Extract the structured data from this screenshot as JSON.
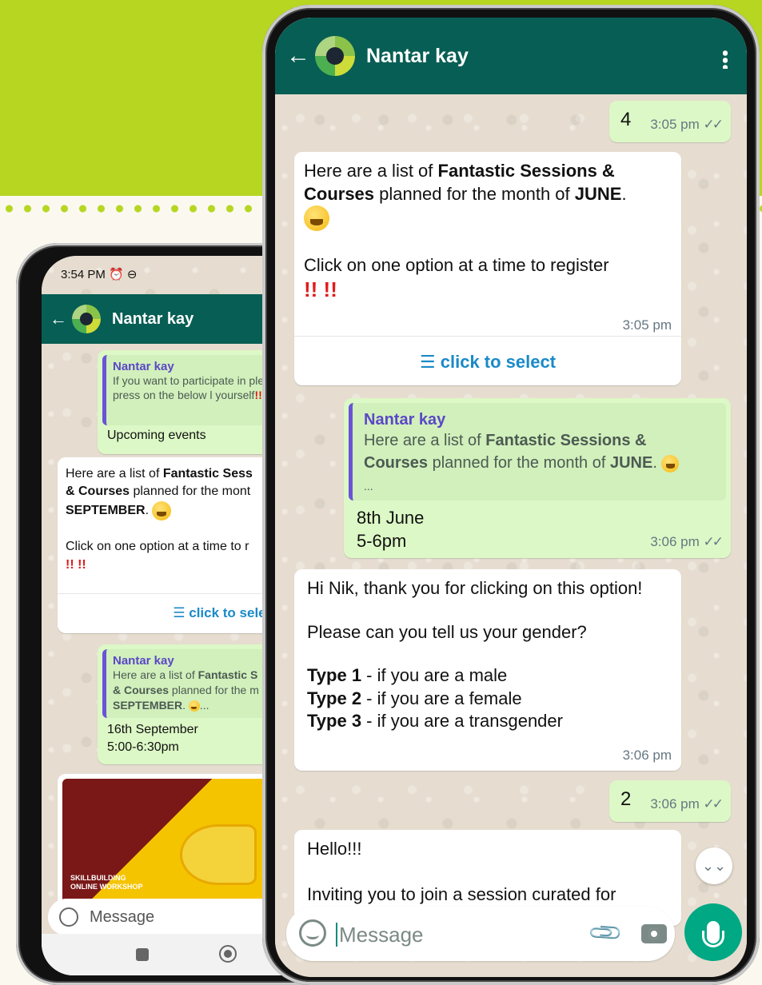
{
  "colors": {
    "brand_band": "#b6d621",
    "appbar": "#075e54",
    "bubble_out": "#dcf8c6",
    "bubble_in": "#ffffff",
    "link": "#1a8ac7",
    "fab": "#00a884"
  },
  "back_phone": {
    "status": {
      "time": "3:54 PM",
      "icons": "⏰ ⊖"
    },
    "header": {
      "back_icon": "←",
      "title": "Nantar kay"
    },
    "messages": [
      {
        "quote_name": "Nantar kay",
        "quote_text": "If you want to participate in please press on the below l yourself",
        "quote_marks": "!!",
        "text": "Upcoming events"
      },
      {
        "text_parts": [
          "Here are a list of ",
          "Fantastic Sess",
          " & Courses",
          " planned for the mont",
          "SEPTEMBER",
          "."
        ],
        "line2": "Click on one option at a time to r",
        "marks": "!! !!",
        "button": "click to select",
        "button_icon": "☰"
      },
      {
        "quote_name": "Nantar kay",
        "quote_text_a": "Here are a list of ",
        "quote_bold_a": "Fantastic S",
        "quote_bold_b": "& Courses",
        "quote_text_b": " planned for the m",
        "quote_bold_c": "SEPTEMBER",
        "quote_tail": "...",
        "date": "16th September",
        "time": "5:00-6:30pm"
      },
      {
        "image_caption_line1": "SKILLBUILDING",
        "image_caption_line2": "ONLINE WORKSHOP"
      }
    ],
    "input_placeholder": "Message"
  },
  "front_phone": {
    "header": {
      "back_icon": "←",
      "title": "Nantar kay",
      "menu_icon": "⋮"
    },
    "messages": {
      "m1": {
        "text": "4",
        "time": "3:05 pm",
        "ticks": "✓✓"
      },
      "m2": {
        "text_a": "Here are a list of ",
        "bold_a": "Fantastic Sessions &",
        "bold_b": "Courses",
        "text_b": " planned for the month of ",
        "bold_c": "JUNE",
        "text_c": ".",
        "line2": "Click on one option at a time to register",
        "marks": "!! !!",
        "time": "3:05 pm",
        "button_icon": "☰",
        "button": "click to select"
      },
      "m3": {
        "quote_name": "Nantar kay",
        "quote_text_a": "Here are a list of ",
        "quote_bold_a": "Fantastic Sessions &",
        "quote_bold_b": "Courses",
        "quote_text_b": " planned for the month of ",
        "quote_bold_c": "JUNE",
        "quote_text_c": ".",
        "quote_tail": "...",
        "date": "8th June",
        "time_range": "5-6pm",
        "time": "3:06 pm",
        "ticks": "✓✓"
      },
      "m4": {
        "line1": "Hi Nik, thank you for clicking on this option!",
        "line2": "Please can you tell us your gender?",
        "opt1_bold": "Type 1",
        "opt1_text": " - if you are a male",
        "opt2_bold": "Type 2",
        "opt2_text": " - if you are a female",
        "opt3_bold": "Type 3",
        "opt3_text": " - if you are a transgender",
        "time": "3:06 pm"
      },
      "m5": {
        "text": "2",
        "time": "3:06 pm",
        "ticks": "✓✓"
      },
      "m6": {
        "line1": "Hello!!!",
        "line2": "Inviting you to join a session curated for"
      }
    },
    "scroll_down_icon": "⌄⌄",
    "input_placeholder": "Message",
    "attach_icon": "📎"
  }
}
